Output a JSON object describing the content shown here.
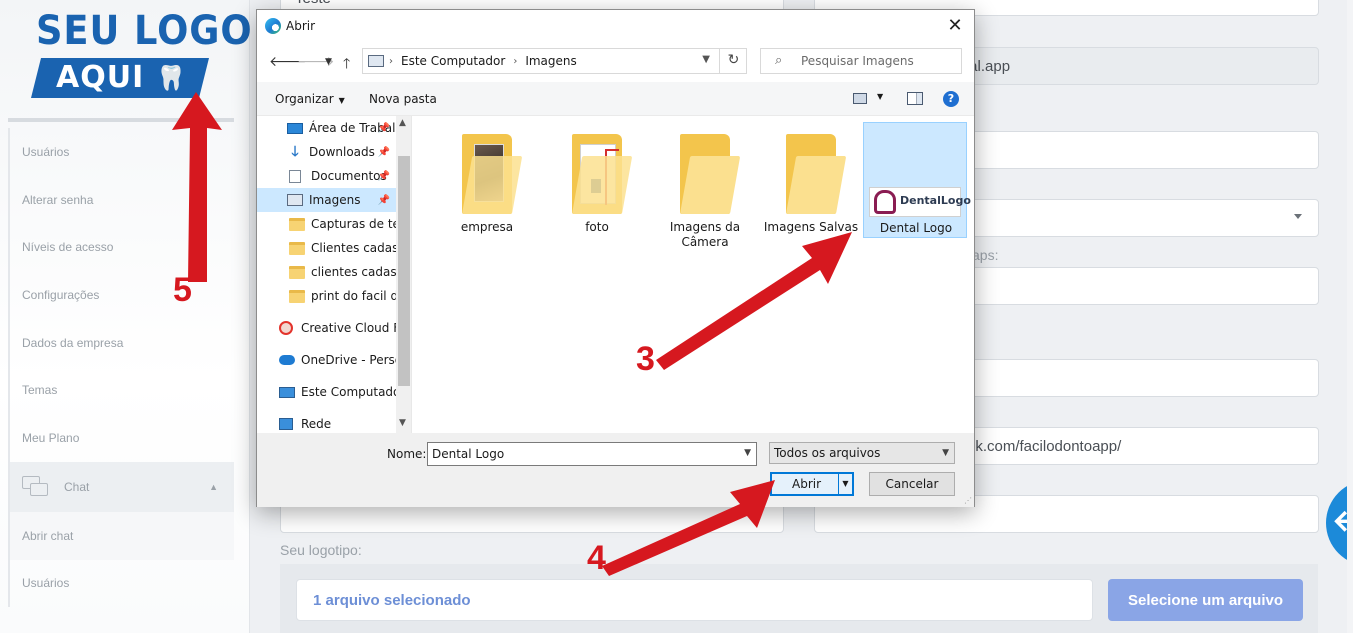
{
  "app": {
    "logo_line1": "SEU LOGO",
    "logo_line2": "AQUI",
    "sidebar": {
      "items": [
        "Usuários",
        "Alterar senha",
        "Níveis de acesso",
        "Configurações",
        "Dados da empresa",
        "Temas",
        "Meu Plano"
      ],
      "chat_group": "Chat",
      "chat_items": [
        "Abrir chat",
        "Usuários"
      ]
    },
    "form": {
      "field_top_left": "Teste",
      "field_domain": "tal.app",
      "label_partial_maps": "aps:",
      "field_facebook": "ok.com/facilodontoapp/",
      "logotipo_label": "Seu logotipo:",
      "upload_status": "1 arquivo selecionado",
      "upload_button": "Selecione um arquivo"
    }
  },
  "dialog": {
    "title": "Abrir",
    "close": "✕",
    "breadcrumb": [
      "Este Computador",
      "Imagens"
    ],
    "search_placeholder": "Pesquisar Imagens",
    "toolbar": {
      "organize": "Organizar",
      "new_folder": "Nova pasta",
      "help": "?"
    },
    "tree": [
      {
        "label": "Área de Trabalho",
        "icon": "desktop-icon",
        "pinned": true
      },
      {
        "label": "Downloads",
        "icon": "download-icon",
        "pinned": true
      },
      {
        "label": "Documentos",
        "icon": "document-icon",
        "pinned": true
      },
      {
        "label": "Imagens",
        "icon": "pictures-icon",
        "pinned": true,
        "selected": true
      },
      {
        "label": "Capturas de tela",
        "icon": "folder-icon"
      },
      {
        "label": "Clientes cadastrados",
        "icon": "folder-icon"
      },
      {
        "label": "clientes cadastrados",
        "icon": "folder-icon"
      },
      {
        "label": "print do facil dental",
        "icon": "folder-icon"
      },
      {
        "label": "Creative Cloud Files",
        "icon": "creative-cloud-icon"
      },
      {
        "label": "OneDrive - Personal",
        "icon": "onedrive-icon"
      },
      {
        "label": "Este Computador",
        "icon": "computer-icon"
      },
      {
        "label": "Rede",
        "icon": "network-icon"
      }
    ],
    "files": [
      {
        "name": "empresa",
        "kind": "folder-photo"
      },
      {
        "name": "foto",
        "kind": "folder-document"
      },
      {
        "name": "Imagens da Câmera",
        "kind": "folder"
      },
      {
        "name": "Imagens Salvas",
        "kind": "folder"
      },
      {
        "name": "Dental Logo",
        "kind": "image",
        "selected": true
      }
    ],
    "dental_thumb_text": "DentalLogo",
    "filename_label": "Nome:",
    "filename_value": "Dental Logo",
    "file_type": "Todos os arquivos",
    "open_button": "Abrir",
    "cancel_button": "Cancelar"
  },
  "annotations": {
    "steps": [
      "5",
      "3",
      "4"
    ],
    "arrow_color": "#d6181f"
  }
}
